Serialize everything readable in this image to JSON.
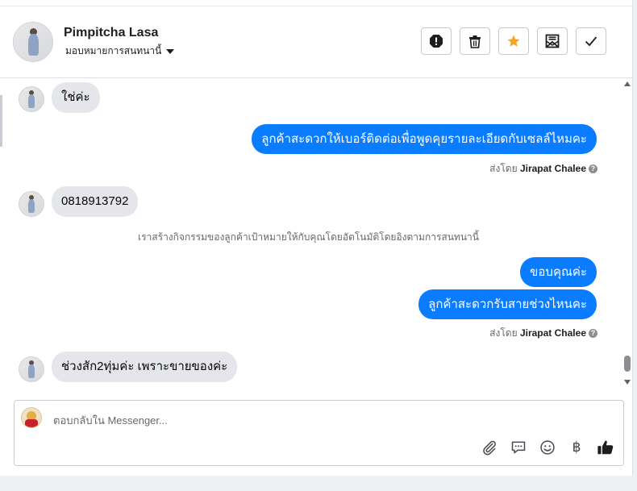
{
  "header": {
    "contact_name": "Pimpitcha Lasa",
    "stage_label": "มอบหมายการสนทนานี้",
    "icons": [
      "spam-icon",
      "trash-icon",
      "star-icon",
      "mark-unread-icon",
      "done-check-icon"
    ],
    "star_color": "#f5a623"
  },
  "messages": [
    {
      "direction": "in",
      "text": "ใช่ค่ะ"
    },
    {
      "direction": "out",
      "text": "ลูกค้าสะดวกให้เบอร์ติดต่อเพื่อพูดคุยรายละเอียดกับเซลล์ไหมคะ"
    },
    {
      "direction": "meta",
      "prefix": "ส่งโดย",
      "agent": "Jirapat Chalee"
    },
    {
      "direction": "in",
      "text": "0818913792"
    },
    {
      "direction": "system",
      "text": "เราสร้างกิจกรรมของลูกค้าเป้าหมายให้กับคุณโดยอัตโนมัติโดยอิงตามการสนทนานี้"
    },
    {
      "direction": "out",
      "text": "ขอบคุณค่ะ"
    },
    {
      "direction": "out",
      "text": "ลูกค้าสะดวกรับสายช่วงไหนคะ"
    },
    {
      "direction": "meta",
      "prefix": "ส่งโดย",
      "agent": "Jirapat Chalee"
    },
    {
      "direction": "in",
      "text": "ช่วงสัก2ทุ่มค่ะ เพราะขายของค่ะ"
    }
  ],
  "composer": {
    "placeholder": "ตอบกลับใน Messenger...",
    "baht_symbol": "฿",
    "tools": [
      "attachment-icon",
      "saved-reply-icon",
      "emoji-icon",
      "payment-baht-icon",
      "like-thumb-icon"
    ]
  },
  "colors": {
    "outgoing_bubble": "#0a7cff",
    "incoming_bubble": "#e4e6eb"
  }
}
